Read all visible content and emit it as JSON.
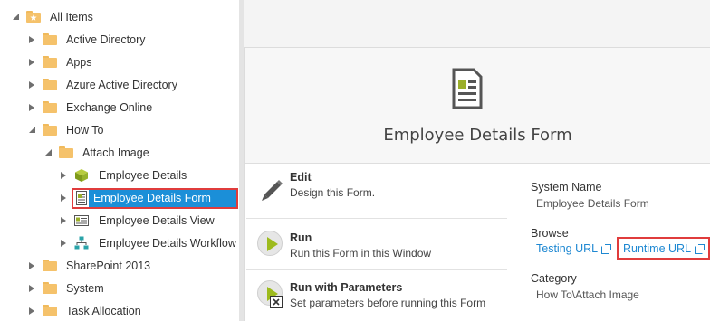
{
  "tree": {
    "root": "All Items",
    "items": [
      {
        "label": "Active Directory"
      },
      {
        "label": "Apps"
      },
      {
        "label": "Azure Active Directory"
      },
      {
        "label": "Exchange Online"
      },
      {
        "label": "How To"
      },
      {
        "label": "Attach Image"
      },
      {
        "label": "Employee Details"
      },
      {
        "label": "Employee Details Form"
      },
      {
        "label": "Employee Details View"
      },
      {
        "label": "Employee Details Workflow"
      },
      {
        "label": "SharePoint 2013"
      },
      {
        "label": "System"
      },
      {
        "label": "Task Allocation"
      }
    ]
  },
  "form": {
    "title": "Employee Details Form",
    "icon": "form-document-icon"
  },
  "actions": [
    {
      "title": "Edit",
      "desc": "Design this Form.",
      "icon": "pencil-icon"
    },
    {
      "title": "Run",
      "desc": "Run this Form in this Window",
      "icon": "play-icon"
    },
    {
      "title": "Run with Parameters",
      "desc": "Set parameters before running this Form",
      "icon": "play-parameters-icon"
    }
  ],
  "properties": {
    "system_name_label": "System Name",
    "system_name_value": "Employee Details Form",
    "browse_label": "Browse",
    "testing_url": "Testing URL",
    "runtime_url": "Runtime URL",
    "category_label": "Category",
    "category_value": "How To\\Attach Image"
  },
  "colors": {
    "selection": "#1b8fd8",
    "highlight_border": "#e03c3c",
    "link": "#1e88d2",
    "folder": "#f5c26b",
    "play_green": "#9dbb1d"
  }
}
